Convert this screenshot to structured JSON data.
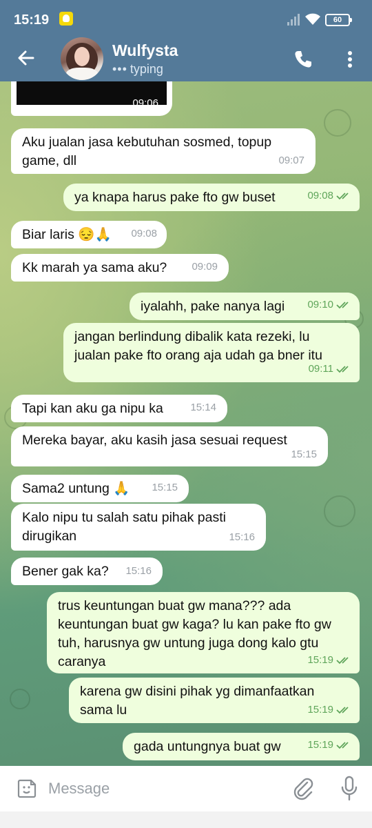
{
  "status_bar": {
    "time": "15:19",
    "battery": "60"
  },
  "header": {
    "contact_name": "Wulfysta",
    "status": "typing"
  },
  "media": {
    "time": "09:06"
  },
  "messages": [
    {
      "dir": "in",
      "text": "Aku jualan jasa kebutuhan sosmed, topup game, dll",
      "time": "09:07"
    },
    {
      "dir": "out",
      "text": "ya knapa harus pake fto gw buset",
      "time": "09:08"
    },
    {
      "dir": "in",
      "text": "Biar laris 😔🙏",
      "time": "09:08"
    },
    {
      "dir": "in",
      "text": "Kk marah ya sama aku?",
      "time": "09:09"
    },
    {
      "dir": "out",
      "text": "iyalahh, pake nanya lagi",
      "time": "09:10"
    },
    {
      "dir": "out",
      "text": "jangan berlindung dibalik kata rezeki, lu jualan pake fto orang aja udah ga bner itu",
      "time": "09:11"
    },
    {
      "dir": "in",
      "text": "Tapi kan aku ga nipu ka",
      "time": "15:14"
    },
    {
      "dir": "in",
      "text": "Mereka bayar, aku kasih jasa sesuai request",
      "time": "15:15"
    },
    {
      "dir": "in",
      "text": "Sama2 untung 🙏",
      "time": "15:15"
    },
    {
      "dir": "in",
      "text": "Kalo nipu tu salah satu pihak pasti dirugikan",
      "time": "15:16"
    },
    {
      "dir": "in",
      "text": "Bener gak ka?",
      "time": "15:16"
    },
    {
      "dir": "out",
      "text": "trus keuntungan buat gw mana??? ada keuntungan buat gw kaga? lu kan pake fto gw tuh, harusnya gw untung juga dong kalo gtu caranya",
      "time": "15:19"
    },
    {
      "dir": "out",
      "text": "karena gw disini pihak yg dimanfaatkan sama lu",
      "time": "15:19"
    },
    {
      "dir": "out",
      "text": "gada untungnya buat gw",
      "time": "15:19"
    }
  ],
  "composer": {
    "placeholder": "Message"
  },
  "colors": {
    "header": "#547a99",
    "incoming": "#ffffff",
    "outgoing": "#effedd",
    "read_ticks": "#5fa55a"
  }
}
